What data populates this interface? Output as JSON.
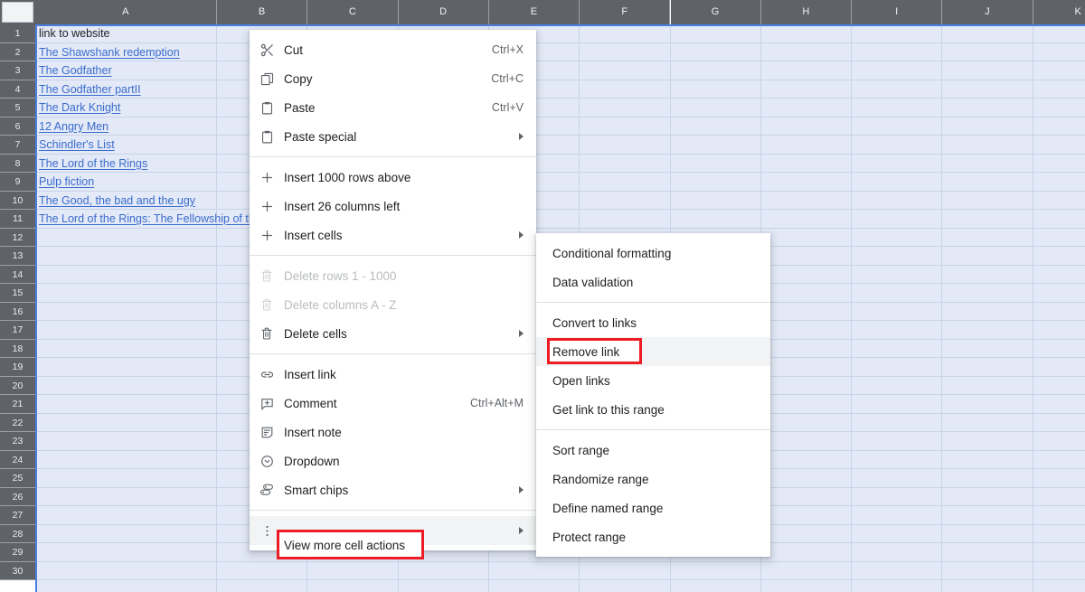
{
  "spreadsheet": {
    "select_all_label": "",
    "columns": [
      "A",
      "B",
      "C",
      "D",
      "E",
      "F",
      "G",
      "H",
      "I",
      "J",
      "K"
    ],
    "rows": [
      1,
      2,
      3,
      4,
      5,
      6,
      7,
      8,
      9,
      10,
      11,
      12,
      13,
      14,
      15,
      16,
      17,
      18,
      19,
      20,
      21,
      22,
      23,
      24,
      25,
      26,
      27,
      28,
      29,
      30
    ],
    "column_a_cells": [
      {
        "row": 1,
        "text": "link to website",
        "is_link": false
      },
      {
        "row": 2,
        "text": "The Shawshank redemption",
        "is_link": true
      },
      {
        "row": 3,
        "text": "The Godfather ",
        "is_link": true
      },
      {
        "row": 4,
        "text": "The Godfather partII",
        "is_link": true
      },
      {
        "row": 5,
        "text": "The Dark Knight ",
        "is_link": true
      },
      {
        "row": 6,
        "text": "12 Angry Men ",
        "is_link": true
      },
      {
        "row": 7,
        "text": "Schindler's List ",
        "is_link": true
      },
      {
        "row": 8,
        "text": "The Lord of the Rings ",
        "is_link": true
      },
      {
        "row": 9,
        "text": "Pulp fiction ",
        "is_link": true
      },
      {
        "row": 10,
        "text": "The Good, the bad and the ugy",
        "is_link": true
      },
      {
        "row": 11,
        "text": "The Lord of the Rings: The Fellowship of the Ring",
        "is_link": true
      }
    ],
    "colors": {
      "header_bg": "#5f6368",
      "selection_bg": "#e3e9f7",
      "gridline": "#c9d3e8",
      "link": "#3b6ccc",
      "selection_border": "#4a7ee0"
    }
  },
  "context_menu": {
    "items": [
      {
        "id": "cut",
        "label": "Cut",
        "accel": "Ctrl+X",
        "icon": "scissors-icon",
        "submenu": false,
        "disabled": false
      },
      {
        "id": "copy",
        "label": "Copy",
        "accel": "Ctrl+C",
        "icon": "copy-icon",
        "submenu": false,
        "disabled": false
      },
      {
        "id": "paste",
        "label": "Paste",
        "accel": "Ctrl+V",
        "icon": "clipboard-icon",
        "submenu": false,
        "disabled": false
      },
      {
        "id": "paste-special",
        "label": "Paste special",
        "accel": "",
        "icon": "clipboard-icon",
        "submenu": true,
        "disabled": false
      },
      {
        "id": "sep1",
        "separator": true
      },
      {
        "id": "insert-rows",
        "label": "Insert 1000 rows above",
        "accel": "",
        "icon": "plus-icon",
        "submenu": false,
        "disabled": false
      },
      {
        "id": "insert-cols",
        "label": "Insert 26 columns left",
        "accel": "",
        "icon": "plus-icon",
        "submenu": false,
        "disabled": false
      },
      {
        "id": "insert-cells",
        "label": "Insert cells",
        "accel": "",
        "icon": "plus-icon",
        "submenu": true,
        "disabled": false
      },
      {
        "id": "sep2",
        "separator": true
      },
      {
        "id": "delete-rows",
        "label": "Delete rows 1 - 1000",
        "accel": "",
        "icon": "trash-icon",
        "submenu": false,
        "disabled": true
      },
      {
        "id": "delete-cols",
        "label": "Delete columns A - Z",
        "accel": "",
        "icon": "trash-icon",
        "submenu": false,
        "disabled": true
      },
      {
        "id": "delete-cells",
        "label": "Delete cells",
        "accel": "",
        "icon": "trash-icon",
        "submenu": true,
        "disabled": false
      },
      {
        "id": "sep3",
        "separator": true
      },
      {
        "id": "insert-link",
        "label": "Insert link",
        "accel": "",
        "icon": "link-icon",
        "submenu": false,
        "disabled": false
      },
      {
        "id": "comment",
        "label": "Comment",
        "accel": "Ctrl+Alt+M",
        "icon": "comment-icon",
        "submenu": false,
        "disabled": false
      },
      {
        "id": "insert-note",
        "label": "Insert note",
        "accel": "",
        "icon": "note-icon",
        "submenu": false,
        "disabled": false
      },
      {
        "id": "dropdown",
        "label": "Dropdown",
        "accel": "",
        "icon": "dropdown-icon",
        "submenu": false,
        "disabled": false
      },
      {
        "id": "smart-chips",
        "label": "Smart chips",
        "accel": "",
        "icon": "smart-chips-icon",
        "submenu": true,
        "disabled": false
      },
      {
        "id": "sep4",
        "separator": true
      },
      {
        "id": "view-more",
        "label": "View more cell actions",
        "accel": "",
        "icon": "more-vert-icon",
        "submenu": true,
        "disabled": false,
        "highlighted": true
      }
    ]
  },
  "submenu": {
    "items": [
      {
        "id": "conditional-formatting",
        "label": "Conditional formatting"
      },
      {
        "id": "data-validation",
        "label": "Data validation"
      },
      {
        "id": "sep1",
        "separator": true
      },
      {
        "id": "convert-to-links",
        "label": "Convert to links"
      },
      {
        "id": "remove-link",
        "label": "Remove link",
        "highlighted": true
      },
      {
        "id": "open-links",
        "label": "Open links"
      },
      {
        "id": "get-link-to-range",
        "label": "Get link to this range"
      },
      {
        "id": "sep2",
        "separator": true
      },
      {
        "id": "sort-range",
        "label": "Sort range"
      },
      {
        "id": "randomize-range",
        "label": "Randomize range"
      },
      {
        "id": "define-named-range",
        "label": "Define named range"
      },
      {
        "id": "protect-range",
        "label": "Protect range"
      }
    ]
  },
  "annotations": {
    "highlight_color": "#ee1c25",
    "boxes": [
      {
        "id": "view-more-cell-actions-box",
        "label": "View more cell actions"
      },
      {
        "id": "remove-link-box",
        "label": "Remove link"
      }
    ]
  }
}
